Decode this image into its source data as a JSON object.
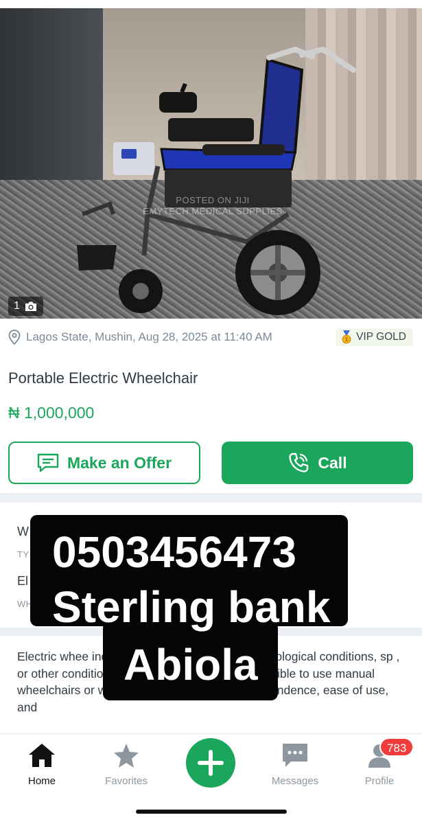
{
  "listing": {
    "photo_counter": "1",
    "watermark_line1": "POSTED ON JIJI",
    "watermark_line2": "EMYTECH MEDICAL SUPPLIES",
    "location_date": "Lagos State, Mushin, Aug 28, 2025 at 11:40 AM",
    "badge": "VIP GOLD",
    "title": "Portable Electric Wheelchair",
    "price": "₦ 1,000,000"
  },
  "actions": {
    "offer_label": "Make an Offer",
    "call_label": "Call"
  },
  "attributes": [
    {
      "value": "W",
      "label": "TY"
    },
    {
      "value": "El",
      "label": "WH"
    }
  ],
  "description": "Electric whee individuals with mobility limita neurological conditions, sp , or other conditions that make it difficult or impossible to use manual wheelchairs or walk. They offer increased independence, ease of use, and",
  "overlay": {
    "line1": "0503456473",
    "line2": "Sterling bank",
    "line3": "Abiola"
  },
  "nav": {
    "home": "Home",
    "favorites": "Favorites",
    "messages": "Messages",
    "profile": "Profile",
    "profile_badge": "783"
  },
  "colors": {
    "accent": "#1aa65b",
    "badge": "#ef3b3b"
  }
}
